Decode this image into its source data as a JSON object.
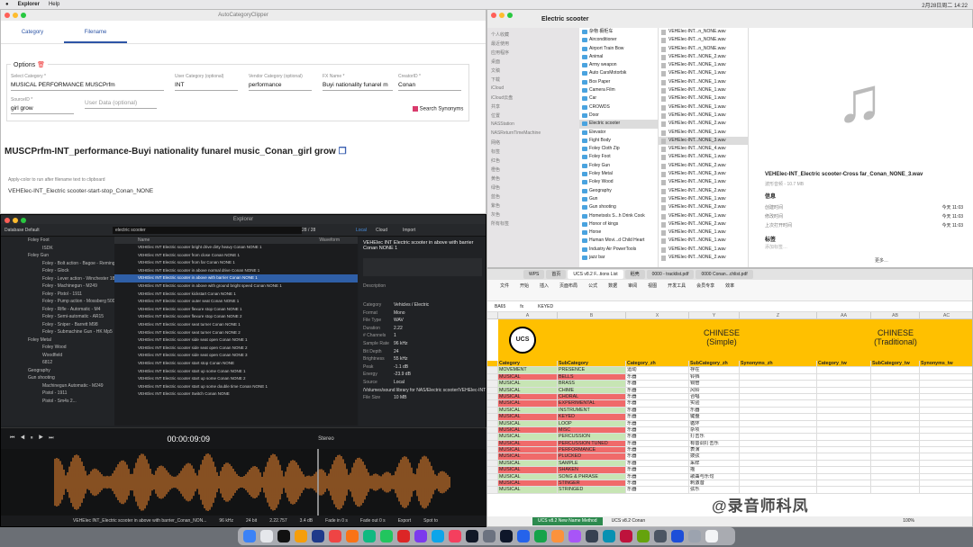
{
  "menubar": {
    "app": "Explorer",
    "help": "Help",
    "date": "2月28日周二 14:22"
  },
  "w1": {
    "title": "AutoCategoryClipper",
    "tabs": [
      "Category",
      "Filename"
    ],
    "options": "Options",
    "fields": [
      {
        "label": "Select Category *",
        "value": "MUSICAL PERFORMANCE MUSCPrfm"
      },
      {
        "label": "User Category (optional)",
        "value": "INT"
      },
      {
        "label": "Vendor Category (optional)",
        "value": "performance"
      },
      {
        "label": "FX Name *",
        "value": "Buyi nationality funarel m"
      },
      {
        "label": "CreatorID *",
        "value": "Conan"
      },
      {
        "label": "SourceID *",
        "value": "girl grow"
      },
      {
        "label": "",
        "value": "User Data (optional)"
      }
    ],
    "search_synonyms": "Search Synonyms",
    "filename": "MUSCPrfm-INT_performance-Buyi nationality funarel music_Conan_girl grow",
    "hint": "Apply-color to run after filename text to clipboard",
    "last": "VEHElec-INT_Electric scooter-start-stop_Conan_NONE"
  },
  "finder": {
    "title": "Electric scooter",
    "sidebar": [
      "个人收藏",
      "最近使用",
      "应用程序",
      "桌面",
      "文稿",
      "下载",
      "iCloud",
      "iCloud云盘",
      "共享",
      "位置",
      "NASStation",
      "NASReturnTimeMachine",
      "网络",
      "标签",
      "红色",
      "橙色",
      "黄色",
      "绿色",
      "蓝色",
      "紫色",
      "灰色",
      "所有标签"
    ],
    "folders": [
      "杂物 橱柜车",
      "Airconditioner",
      "Airport Train Bow",
      "Animal",
      "Army weapon",
      "Auto CarsMotorbik",
      "Box Paper",
      "Camera Film",
      "Car",
      "CROWDS",
      "Door",
      "Electric scooter",
      "Elevator",
      "Fight Body",
      "Foley Cloth Zip",
      "Foley Foot",
      "Foley Gun",
      "Foley Metal",
      "Foley Wood",
      "Geography",
      "Gun",
      "Gun shooting",
      "Hometools S...h Drink Cook",
      "Honor of kings",
      "Horse",
      "Human Movi...d Child Heart",
      "Industry Air PowerTools",
      "jazz bar"
    ],
    "files": [
      "VEHElec-INT...n_NONE.wav",
      "VEHElec-INT...n_NONE.wav",
      "VEHElec-INT...n_NONE.wav",
      "VEHElec-INT...NONE_2.wav",
      "VEHElec-INT...NONE_1.wav",
      "VEHElec-INT...NONE_1.wav",
      "VEHElec-INT...NONE_1.wav",
      "VEHElec-INT...NONE_1.wav",
      "VEHElec-INT...NONE_1.wav",
      "VEHElec-INT...NONE_1.wav",
      "VEHElec-INT...NONE_1.wav",
      "VEHElec-INT...NONE_2.wav",
      "VEHElec-INT...NONE_1.wav",
      "VEHElec-INT...NONE_3.wav",
      "VEHElec-INT...NONE_4.wav",
      "VEHElec-INT...NONE_1.wav",
      "VEHElec-INT...NONE_2.wav",
      "VEHElec-INT...NONE_3.wav",
      "VEHElec-INT...NONE_1.wav",
      "VEHElec-INT...NONE_2.wav",
      "VEHElec-INT...NONE_1.wav",
      "VEHElec-INT...NONE_2.wav",
      "VEHElec-INT...NONE_1.wav",
      "VEHElec-INT...NONE_2.wav",
      "VEHElec-INT...NONE_1.wav",
      "VEHElec-INT...NONE_1.wav",
      "VEHElec-INT...NONE_1.wav",
      "VEHElec-INT...NONE_2.wav"
    ],
    "preview_name": "VEHElec-INT_Electric scooter-Cross far_Conan_NONE_3.wav",
    "preview_sub": "波形音频 - 10.7 MB",
    "info": "信息",
    "created": "创建时间",
    "created_v": "今天 11:03",
    "modified": "修改时间",
    "modified_v": "今天 11:03",
    "opened": "上次打开时间",
    "opened_v": "今天 11:03",
    "tags": "标签",
    "addtag": "添加标签…",
    "more": "更多…"
  },
  "explorer": {
    "title": "Explorer",
    "db": "Database Default",
    "search": "electric scooter",
    "count": "28 / 28",
    "tabs": [
      "Local",
      "Cloud",
      "Import"
    ],
    "filters": [
      "electric",
      "scooter"
    ],
    "tree": [
      "Foley Foot",
      "ISDK",
      "Foley Gun",
      "Foley - Bolt action - Bagoe - Remington",
      "Foley - Glock",
      "Foley - Lever action - Winchester 1886",
      "Foley - Machinegun - M249",
      "Foley - Pistol - 1911",
      "Foley - Pump action - Mossberg 500",
      "Foley - Rifle - Automatic - M4",
      "Foley - Semi-automatic - AR15",
      "Foley - Sniper - Barrett M98",
      "Foley - Submachine Gun - HK Mp5",
      "Foley Metal",
      "Foley Wood",
      "Woodfield",
      "6812",
      "Geography",
      "Gun shooting",
      "Machinegun Automatic - M249",
      "Pistol - 1911",
      "Pistol - Sm4s 2..."
    ],
    "header": "Name",
    "waveform_header": "Waveform",
    "rows": [
      "VEHElec INT Electric scooter bright drive dirty heavy Conan NONE 1",
      "VEHElec INT Electric scooter from close Conan NONE 1",
      "VEHElec INT Electric scooter from far Conan NONE 1",
      "VEHElec INT Electric scooter in above normal drive Conan NONE 1",
      "VEHElec INT Electric scooter in above with barrier Conan NONE 1",
      "VEHElec INT Electric scooter in above with ground bright speed Conan NONE 1",
      "VEHElec INT Electric scooter kickstart Conan NONE 1",
      "VEHElec INT Electric scooter outer seat Conan NONE 1",
      "VEHElec INT Electric scooter flexure stop Conan NONE 1",
      "VEHElec INT Electric scooter flexure stop Conan NONE 2",
      "VEHElec INT Electric scooter seat turner Conan NONE 1",
      "VEHElec INT Electric scooter seat turner Conan NONE 2",
      "VEHElec INT Electric scooter side seat open Conan NONE 1",
      "VEHElec INT Electric scooter side seat open Conan NONE 2",
      "VEHElec INT Electric scooter side seat open Conan NONE 3",
      "VEHElec INT Electric scooter start stop Conan NONE",
      "VEHElec INT Electric scooter start up some Conan NONE 1",
      "VEHElec INT Electric scooter start up some Conan NONE 2",
      "VEHElec INT Electric scooter start up some double time Conan NONE 1",
      "VEHElec INT Electric scooter Switch Conan NONE"
    ],
    "selected_title": "VEHElec INT Electric scooter in above with barrier Conan NONE 1",
    "description": "Description",
    "props": [
      [
        "Category",
        "Vehicles / Electric"
      ],
      [
        "Format",
        "Mono"
      ],
      [
        "File Type",
        "WAV"
      ],
      [
        "Duration",
        "2.22"
      ],
      [
        "# Channels",
        "1"
      ],
      [
        "Sample Rate",
        "96 kHz"
      ],
      [
        "Bit Depth",
        "24"
      ],
      [
        "Brightness",
        "55 kHz"
      ],
      [
        "Peak",
        "-1.1 dB"
      ],
      [
        "Energy",
        "-23.9 dB"
      ],
      [
        "Source",
        "Local"
      ],
      [
        "",
        "/Volumes/sound library for NAS/Electric scooter/VEHElec-INT_Electric scooter in above with barrier_Conan_NONE_1.wav"
      ],
      [
        "File Size",
        "10 MB"
      ]
    ],
    "timecode": "00:00:09:09",
    "transport": [
      "Stereo"
    ],
    "status": [
      "VEHElec INT_Electric scooter in above with barrier_Conan_NON...",
      "96 kHz",
      "24 bit",
      "2.22.757",
      "3.4 dB",
      "Fade in 0 s",
      "Fade out 0 s",
      "Export",
      "Spot to"
    ]
  },
  "sheet": {
    "tabs": [
      "WPS",
      "首页",
      "UCS v8.2 F...tions List",
      "稻壳",
      "0000 - tracklist.pdf",
      "0000 Conan...chlist.pdf"
    ],
    "ribbon": [
      "文件",
      "开始",
      "插入",
      "页面布局",
      "公式",
      "数据",
      "审阅",
      "视图",
      "开发工具",
      "会员专享",
      "效率"
    ],
    "namebox": "BA65",
    "formula": "KEYED",
    "band_chinese": "CHINESE",
    "band_simple": "(Simple)",
    "band_trad": "(Traditional)",
    "logo": "UCS",
    "headers": [
      "Category",
      "SubCategory",
      "Category_zh",
      "SubCategory_zh",
      "Synonyms_zh",
      "Category_tw",
      "SubCategory_tw",
      "Synonyms_tw"
    ],
    "rows": [
      [
        "MOVEMENT",
        "PRESENCE",
        "运动",
        "存在"
      ],
      [
        "MUSICAL",
        "BELLS",
        "乐器",
        "铃铛"
      ],
      [
        "MUSICAL",
        "BRASS",
        "乐器",
        "铜管"
      ],
      [
        "MUSICAL",
        "CHIME",
        "乐器",
        "风铃"
      ],
      [
        "MUSICAL",
        "CHORAL",
        "乐器",
        "合唱"
      ],
      [
        "MUSICAL",
        "EXPERIMENTAL",
        "乐器",
        "实验"
      ],
      [
        "MUSICAL",
        "INSTRUMENT",
        "乐器",
        "乐器"
      ],
      [
        "MUSICAL",
        "KEYED",
        "乐器",
        "键盘"
      ],
      [
        "MUSICAL",
        "LOOP",
        "乐器",
        "循环"
      ],
      [
        "MUSICAL",
        "MISC",
        "乐器",
        "杂项"
      ],
      [
        "MUSICAL",
        "PERCUSSION",
        "乐器",
        "打击乐"
      ],
      [
        "MUSICAL",
        "PERCUSSION TUNED",
        "乐器",
        "有音调打击乐"
      ],
      [
        "MUSICAL",
        "PERFORMANCE",
        "乐器",
        "表演"
      ],
      [
        "MUSICAL",
        "PLUCKED",
        "乐器",
        "拨弦"
      ],
      [
        "MUSICAL",
        "SAMPLE",
        "乐器",
        "采样"
      ],
      [
        "MUSICAL",
        "SHAKEN",
        "乐器",
        "摇"
      ],
      [
        "MUSICAL",
        "SONG & PHRASE",
        "乐器",
        "歌曲与乐句"
      ],
      [
        "MUSICAL",
        "STINGER",
        "乐器",
        "刺激音"
      ],
      [
        "MUSICAL",
        "STRINGED",
        "乐器",
        "弦乐"
      ]
    ],
    "sheettabs": [
      "UCS v8.2 New Name Method",
      "UCS v8.2 Conan"
    ],
    "zoom": "100%"
  },
  "watermark": "@录音师科凤"
}
